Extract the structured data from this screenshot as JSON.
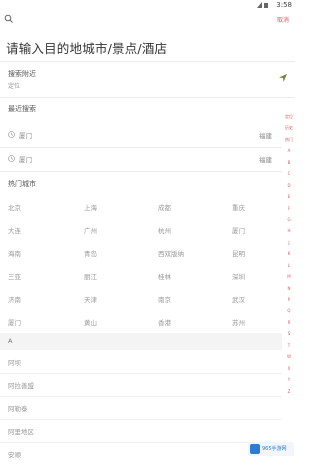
{
  "status_bar": {
    "clock": "3:58"
  },
  "toolbar": {
    "cancel_label": "取消"
  },
  "search": {
    "title": "请输入目的地城市/景点/酒店"
  },
  "location": {
    "label": "搜索附近",
    "value": "定位"
  },
  "recent": {
    "title": "最近搜索",
    "items": [
      {
        "name": "厦门",
        "province": "福建"
      },
      {
        "name": "厦门",
        "province": "福建"
      }
    ]
  },
  "hot": {
    "title": "热门城市",
    "cities": [
      "北京",
      "上海",
      "成都",
      "重庆",
      "大连",
      "广州",
      "杭州",
      "厦门",
      "海南",
      "青岛",
      "西双版纳",
      "昆明",
      "三亚",
      "丽江",
      "桂林",
      "深圳",
      "济南",
      "天津",
      "南京",
      "武汉",
      "厦门",
      "黄山",
      "香港",
      "苏州"
    ]
  },
  "letter_group": {
    "letter": "A",
    "cities": [
      "阿坝",
      "阿拉善盟",
      "阿勒泰",
      "阿里地区",
      "安顺"
    ]
  },
  "index_bar": [
    "定位",
    "历史",
    "热门",
    "A",
    "B",
    "C",
    "D",
    "E",
    "F",
    "G",
    "H",
    "J",
    "K",
    "L",
    "M",
    "N",
    "P",
    "Q",
    "R",
    "S",
    "T",
    "W",
    "X",
    "Y",
    "Z"
  ],
  "watermark": {
    "text": "965手游网"
  }
}
